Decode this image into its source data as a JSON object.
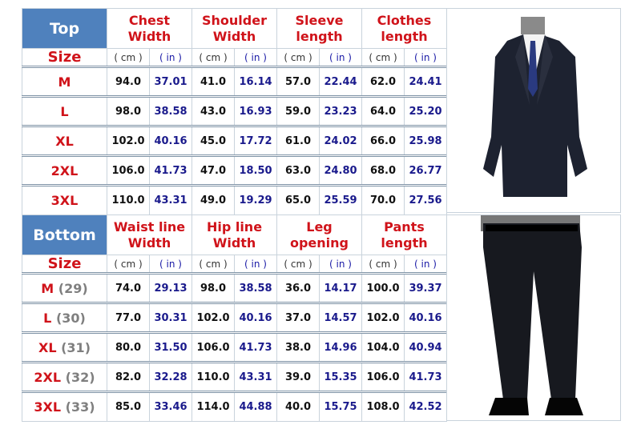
{
  "top": {
    "tag": "Top",
    "size_label": "Size",
    "headers": [
      [
        "Chest",
        "Width"
      ],
      [
        "Shoulder",
        "Width"
      ],
      [
        "Sleeve",
        "length"
      ],
      [
        "Clothes",
        "length"
      ]
    ],
    "unit_cm": "( cm )",
    "unit_in": "( in )",
    "rows": [
      {
        "size": "M",
        "v": [
          "94.0",
          "37.01",
          "41.0",
          "16.14",
          "57.0",
          "22.44",
          "62.0",
          "24.41"
        ]
      },
      {
        "size": "L",
        "v": [
          "98.0",
          "38.58",
          "43.0",
          "16.93",
          "59.0",
          "23.23",
          "64.0",
          "25.20"
        ]
      },
      {
        "size": "XL",
        "v": [
          "102.0",
          "40.16",
          "45.0",
          "17.72",
          "61.0",
          "24.02",
          "66.0",
          "25.98"
        ]
      },
      {
        "size": "2XL",
        "v": [
          "106.0",
          "41.73",
          "47.0",
          "18.50",
          "63.0",
          "24.80",
          "68.0",
          "26.77"
        ]
      },
      {
        "size": "3XL",
        "v": [
          "110.0",
          "43.31",
          "49.0",
          "19.29",
          "65.0",
          "25.59",
          "70.0",
          "27.56"
        ]
      }
    ]
  },
  "bottom": {
    "tag": "Bottom",
    "size_label": "Size",
    "headers": [
      [
        "Waist line",
        "Width"
      ],
      [
        "Hip line",
        "Width"
      ],
      [
        "Leg",
        "opening"
      ],
      [
        "Pants",
        "length"
      ]
    ],
    "unit_cm": "( cm )",
    "unit_in": "( in )",
    "rows": [
      {
        "size": "M",
        "num": "(29)",
        "v": [
          "74.0",
          "29.13",
          "98.0",
          "38.58",
          "36.0",
          "14.17",
          "100.0",
          "39.37"
        ]
      },
      {
        "size": "L",
        "num": "(30)",
        "v": [
          "77.0",
          "30.31",
          "102.0",
          "40.16",
          "37.0",
          "14.57",
          "102.0",
          "40.16"
        ]
      },
      {
        "size": "XL",
        "num": "(31)",
        "v": [
          "80.0",
          "31.50",
          "106.0",
          "41.73",
          "38.0",
          "14.96",
          "104.0",
          "40.94"
        ]
      },
      {
        "size": "2XL",
        "num": "(32)",
        "v": [
          "82.0",
          "32.28",
          "110.0",
          "43.31",
          "39.0",
          "15.35",
          "106.0",
          "41.73"
        ]
      },
      {
        "size": "3XL",
        "num": "(33)",
        "v": [
          "85.0",
          "33.46",
          "114.0",
          "44.88",
          "40.0",
          "15.75",
          "108.0",
          "42.52"
        ]
      }
    ]
  },
  "colors": {
    "tag_bg": "#4f81bd",
    "header_red": "#d0131a",
    "in_blue": "#1a1a8c"
  }
}
